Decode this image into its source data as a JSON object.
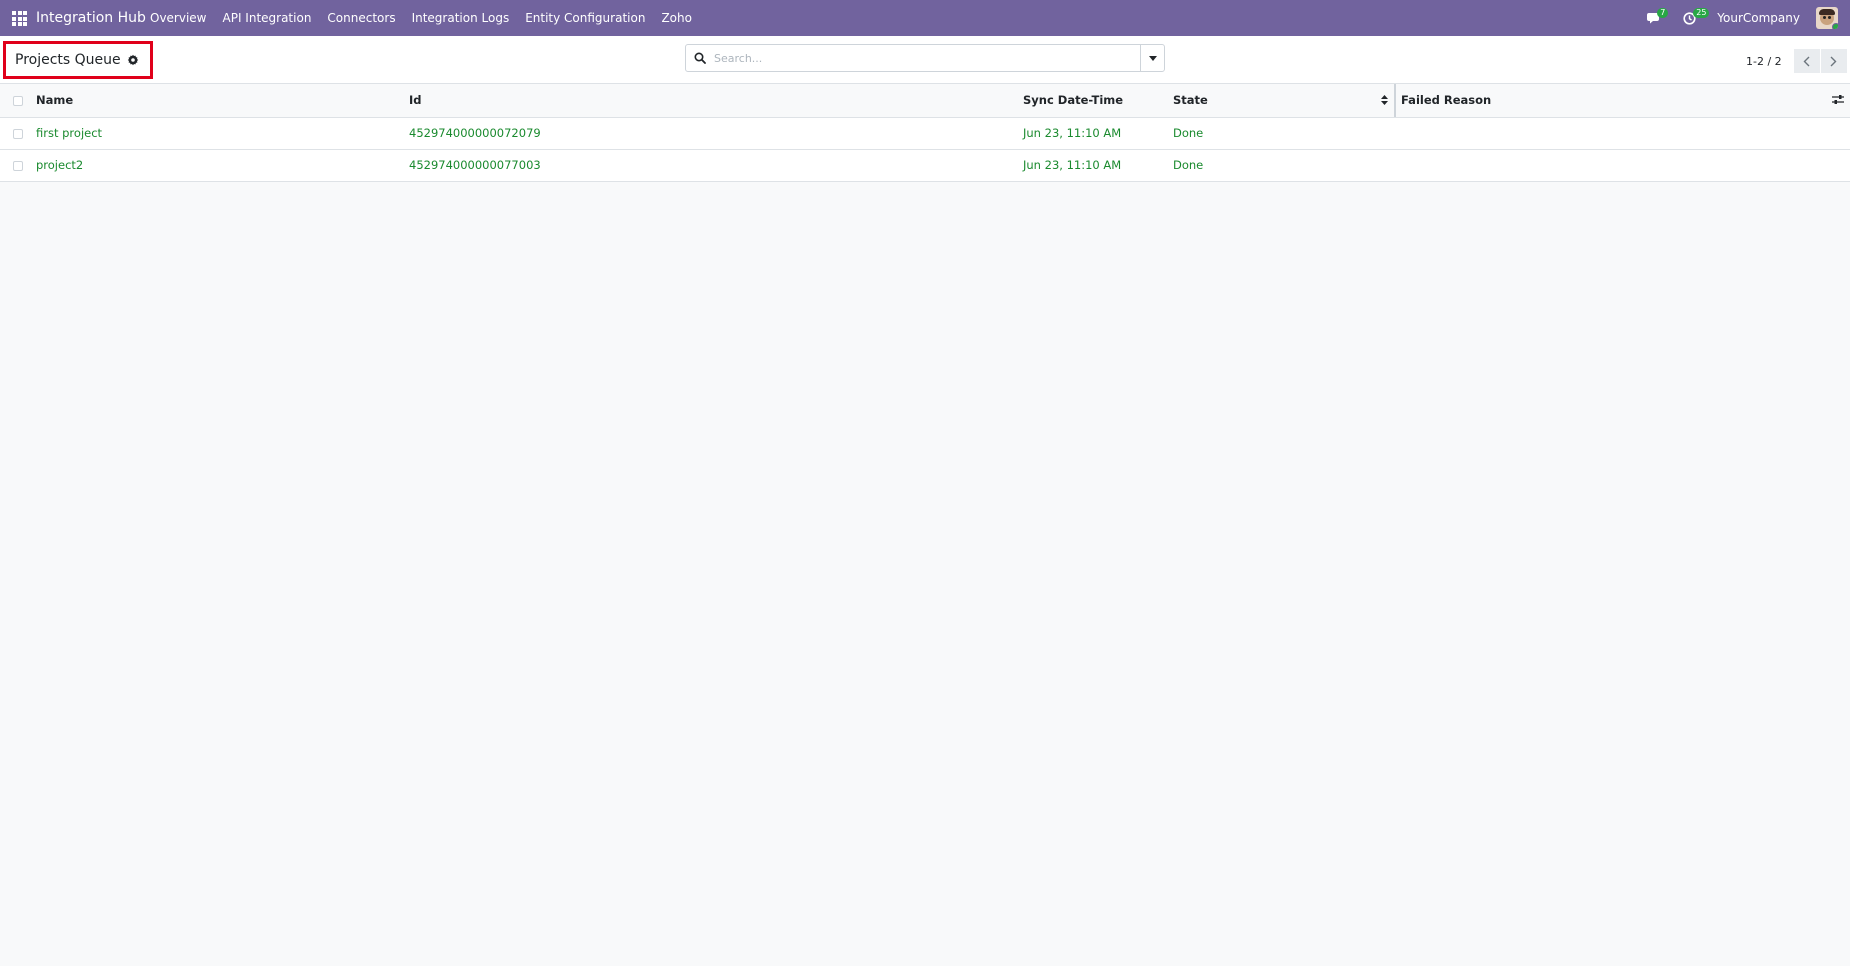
{
  "navbar": {
    "brand": "Integration Hub",
    "menu": [
      "Overview",
      "API Integration",
      "Connectors",
      "Integration Logs",
      "Entity Configuration",
      "Zoho"
    ],
    "messages_count": "7",
    "activities_count": "25",
    "company": "YourCompany"
  },
  "control_panel": {
    "title": "Projects Queue",
    "search_placeholder": "Search...",
    "pager": "1-2 / 2"
  },
  "table": {
    "columns": [
      "Name",
      "Id",
      "Sync Date-Time",
      "State",
      "Failed Reason"
    ],
    "rows": [
      {
        "name": "first project",
        "id": "452974000000072079",
        "sync": "Jun 23, 11:10 AM",
        "state": "Done",
        "failed_reason": ""
      },
      {
        "name": "project2",
        "id": "452974000000077003",
        "sync": "Jun 23, 11:10 AM",
        "state": "Done",
        "failed_reason": ""
      }
    ]
  },
  "colors": {
    "navbar": "#71639e",
    "link_green": "#1a8a2e",
    "highlight_red": "#e0001a"
  }
}
